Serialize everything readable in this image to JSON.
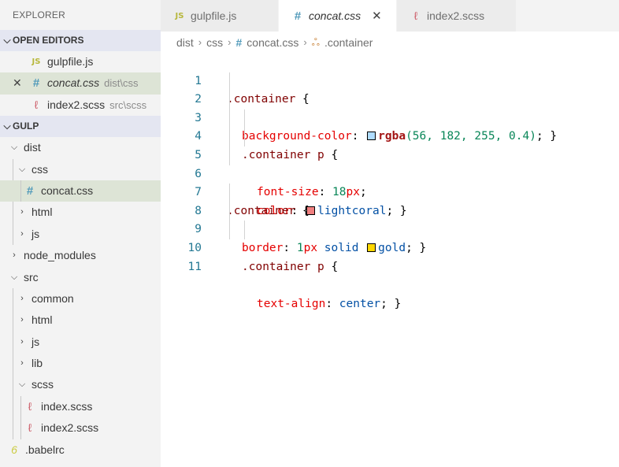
{
  "sidebar": {
    "title": "EXPLORER",
    "open_editors": {
      "heading": "OPEN EDITORS",
      "items": [
        {
          "icon": "JS",
          "name": "gulpfile.js",
          "desc": ""
        },
        {
          "icon": "#",
          "name": "concat.css",
          "desc": "dist\\css"
        },
        {
          "icon": "scss-icon",
          "name": "index2.scss",
          "desc": "src\\scss"
        }
      ]
    },
    "project": {
      "heading": "GULP",
      "tree": [
        {
          "label": "dist",
          "type": "folder",
          "expanded": true
        },
        {
          "label": "css",
          "type": "folder",
          "expanded": true
        },
        {
          "label": "concat.css",
          "type": "css"
        },
        {
          "label": "html",
          "type": "folder",
          "expanded": false
        },
        {
          "label": "js",
          "type": "folder",
          "expanded": false
        },
        {
          "label": "node_modules",
          "type": "folder",
          "expanded": false
        },
        {
          "label": "src",
          "type": "folder",
          "expanded": true
        },
        {
          "label": "common",
          "type": "folder",
          "expanded": false
        },
        {
          "label": "html",
          "type": "folder",
          "expanded": false
        },
        {
          "label": "js",
          "type": "folder",
          "expanded": false
        },
        {
          "label": "lib",
          "type": "folder",
          "expanded": false
        },
        {
          "label": "scss",
          "type": "folder",
          "expanded": true
        },
        {
          "label": "index.scss",
          "type": "scss"
        },
        {
          "label": "index2.scss",
          "type": "scss"
        },
        {
          "label": ".babelrc",
          "type": "babel"
        }
      ]
    }
  },
  "tabs": [
    {
      "icon": "JS",
      "label": "gulpfile.js"
    },
    {
      "icon": "#",
      "label": "concat.css"
    },
    {
      "icon": "scss-icon",
      "label": "index2.scss"
    }
  ],
  "breadcrumb": [
    "dist",
    "css",
    "concat.css",
    ".container"
  ],
  "code": {
    "line_numbers": [
      "1",
      "2",
      "3",
      "4",
      "5",
      "6",
      "7",
      "8",
      "9",
      "10",
      "11"
    ],
    "l1": {
      "sel": ".container",
      "brace": " {"
    },
    "l2": {
      "prop": "background-color",
      "colon": ": ",
      "fn": "rgba",
      "args": "(56, 182, 255, 0.4)",
      "end": "; }"
    },
    "l3": {
      "sel": ".container",
      "tag": " p",
      "brace": " {"
    },
    "l4": {
      "prop": "font-size",
      "colon": ": ",
      "num": "18",
      "unit": "px",
      "end": ";"
    },
    "l5": {
      "prop": "color",
      "colon": ": ",
      "val": "lightcoral",
      "end": "; }"
    },
    "l7": {
      "sel": ".container",
      "brace": " {"
    },
    "l8": {
      "prop": "border",
      "colon": ": ",
      "num": "1",
      "unit": "px",
      "kw": " solid ",
      "val": "gold",
      "end": "; }"
    },
    "l9": {
      "sel": ".container",
      "tag": " p",
      "brace": " {"
    },
    "l10": {
      "prop": "text-align",
      "colon": ": ",
      "val": "center",
      "end": "; }"
    }
  },
  "colors": {
    "swatch_rgba": "#afdcff",
    "swatch_lightcoral": "#f08080",
    "swatch_gold": "#ffd700"
  }
}
